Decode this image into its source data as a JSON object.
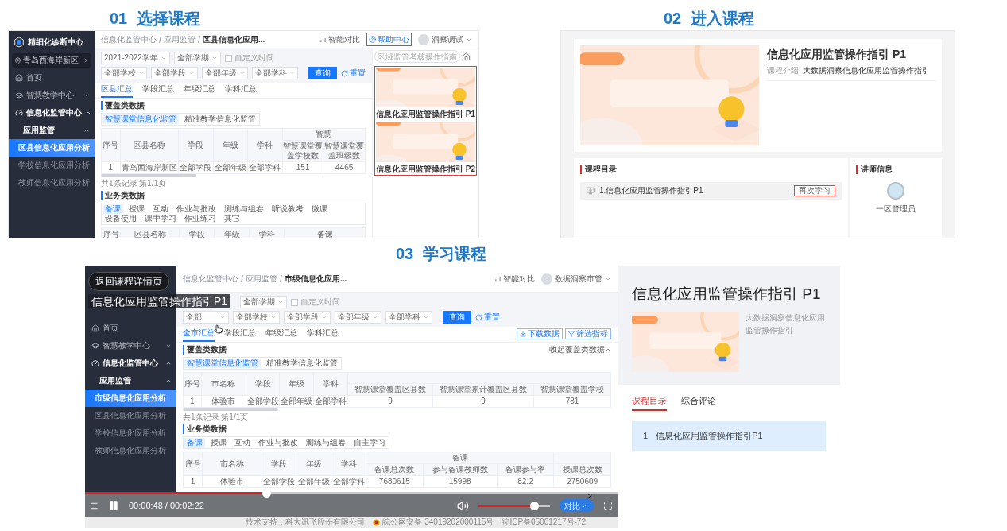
{
  "headings": [
    {
      "number": "01",
      "title": "选择课程"
    },
    {
      "number": "02",
      "title": "进入课程"
    },
    {
      "number": "03",
      "title": "学习课程"
    }
  ],
  "step1": {
    "sidebar": {
      "logo": "精细化诊断中心",
      "region": "青岛西海岸新区",
      "nav": [
        {
          "label": "首页"
        },
        {
          "label": "智慧教学中心",
          "expanded": false
        },
        {
          "label": "信息化监管中心",
          "expanded": true,
          "children": [
            {
              "label": "应用监管",
              "expanded": true,
              "children": [
                {
                  "label": "区县信息化应用分析",
                  "selected": true
                },
                {
                  "label": "学校信息化应用分析",
                  "selected": false
                },
                {
                  "label": "教师信息化应用分析",
                  "selected": false
                }
              ]
            }
          ]
        }
      ]
    },
    "breadcrumb": [
      "信息化监管中心",
      "应用监管",
      "区县信息化应用..."
    ],
    "compare": "智能对比",
    "help": {
      "label": "帮助中心",
      "highlighted": true
    },
    "user": "洞察调试",
    "filters": [
      [
        {
          "kind": "select",
          "value": "2021-2022学年"
        },
        {
          "kind": "select",
          "value": "全部学期"
        },
        {
          "kind": "checkbox",
          "label": "自定义时间",
          "checked": false
        }
      ],
      [
        {
          "kind": "select",
          "value": "全部学校"
        },
        {
          "kind": "select",
          "value": "全部学段"
        },
        {
          "kind": "select",
          "value": "全部年级"
        },
        {
          "kind": "select",
          "value": "全部学科"
        },
        {
          "kind": "button",
          "label": "查询"
        },
        {
          "kind": "link",
          "label": "重置"
        }
      ]
    ],
    "tabs": [
      {
        "label": "区县汇总",
        "selected": true
      },
      {
        "label": "学段汇总",
        "selected": false
      },
      {
        "label": "年级汇总",
        "selected": false
      },
      {
        "label": "学科汇总",
        "selected": false
      }
    ],
    "coverage": {
      "title": "覆盖类数据",
      "subtabs": [
        {
          "label": "智慧课堂信息化监管",
          "selected": true
        },
        {
          "label": "精准教学信息化监管",
          "selected": false
        }
      ],
      "table": {
        "columns": [
          "序号",
          "区县名称",
          "学段",
          "年级",
          "学科"
        ],
        "groups": [
          {
            "label": "智慧",
            "columns": [
              "智慧课堂覆盖学校数",
              "智慧课堂覆盖班级数"
            ]
          }
        ],
        "rows": [
          [
            "1",
            "青岛西海岸新区",
            "全部学段",
            "全部年级",
            "全部学科",
            "151",
            "4465"
          ]
        ]
      },
      "pagination": "共1条记录 第1/1页"
    },
    "business": {
      "title": "业务类数据",
      "subtabs": [
        {
          "label": "备课",
          "selected": true
        },
        {
          "label": "授课",
          "selected": false
        },
        {
          "label": "互动",
          "selected": false
        },
        {
          "label": "作业与批改",
          "selected": false
        },
        {
          "label": "测练与组卷",
          "selected": false
        },
        {
          "label": "听说教考",
          "selected": false
        },
        {
          "label": "微课",
          "selected": false
        },
        {
          "label": "设备使用",
          "selected": false
        },
        {
          "label": "课中学习",
          "selected": false
        },
        {
          "label": "作业练习",
          "selected": false
        },
        {
          "label": "其它",
          "selected": false
        }
      ],
      "table": {
        "columns": [
          "序号",
          "区县名称",
          "学段",
          "年级",
          "学科"
        ],
        "groups": [
          {
            "label": "备课"
          }
        ]
      }
    },
    "help_panel": {
      "search_placeholder": "区域监管考核操作指南",
      "highlighted": true,
      "cards": [
        {
          "kind": "picture",
          "title": "信息化应用监管操作指引 P1"
        },
        {
          "kind": "picture",
          "title": "信息化应用监管操作指引 P2"
        }
      ]
    }
  },
  "step2": {
    "course": {
      "kind": "picture",
      "title": "信息化应用监管操作指引 P1",
      "intro_label": "课程介绍:",
      "intro": "大数据洞察信息化应用监管操作指引"
    },
    "catalog": {
      "title": "课程目录",
      "items": [
        {
          "title": "1.信息化应用监管操作指引P1",
          "action": "再次学习",
          "highlighted": true
        }
      ]
    },
    "lecturer": {
      "title": "讲师信息",
      "name": "一区管理员"
    }
  },
  "step3": {
    "player": {
      "back": "返回课程详情页",
      "title": "信息化应用监管操作指引P1",
      "page": {
        "sidebar": {
          "nav": [
            {
              "label": "首页"
            },
            {
              "label": "智慧教学中心",
              "expanded": false
            },
            {
              "label": "信息化监管中心",
              "expanded": true,
              "children": [
                {
                  "label": "应用监管",
                  "expanded": true,
                  "children": [
                    {
                      "label": "市级信息化应用分析",
                      "selected": true
                    },
                    {
                      "label": "区县信息化应用分析",
                      "selected": false
                    },
                    {
                      "label": "学校信息化应用分析",
                      "selected": false
                    },
                    {
                      "label": "教师信息化应用分析",
                      "selected": false
                    }
                  ]
                }
              ]
            }
          ]
        },
        "breadcrumb": [
          "信息化监管中心",
          "应用监管",
          "市级信息化应用..."
        ],
        "compare": "智能对比",
        "user": "数据洞察市管",
        "filters": [
          [
            {
              "kind": "select",
              "value": "全部学期"
            },
            {
              "kind": "checkbox",
              "label": "自定义时间",
              "checked": false
            }
          ],
          [
            {
              "kind": "select",
              "value": "全部"
            },
            {
              "kind": "select",
              "value": "全部学校"
            },
            {
              "kind": "select",
              "value": "全部学段"
            },
            {
              "kind": "select",
              "value": "全部年级"
            },
            {
              "kind": "select",
              "value": "全部学科"
            },
            {
              "kind": "button",
              "label": "查询"
            },
            {
              "kind": "link",
              "label": "重置"
            }
          ]
        ],
        "tabs": [
          {
            "label": "全市汇总",
            "selected": true
          },
          {
            "label": "学段汇总",
            "selected": false
          },
          {
            "label": "年级汇总",
            "selected": false
          },
          {
            "label": "学科汇总",
            "selected": false
          }
        ],
        "tab_actions": [
          "下载数据",
          "筛选指标"
        ],
        "coverage": {
          "title": "覆盖类数据",
          "toggle": "收起覆盖类数据",
          "subtabs": [
            {
              "label": "智慧课堂信息化监管",
              "selected": true
            },
            {
              "label": "精准教学信息化监管",
              "selected": false
            }
          ],
          "table": {
            "columns": [
              "序号",
              "市名称",
              "学段",
              "年级",
              "学科"
            ],
            "groups": [
              {
                "columns": [
                  "智慧课堂覆盖区县数",
                  "智慧课堂累计覆盖区县数",
                  "智慧课堂覆盖学校"
                ]
              }
            ],
            "rows": [
              [
                "1",
                "体验市",
                "全部学段",
                "全部年级",
                "全部学科",
                "9",
                "9",
                "781"
              ]
            ]
          },
          "pagination": "共1条记录 第1/1页"
        },
        "business": {
          "title": "业务类数据",
          "subtabs": [
            {
              "label": "备课",
              "selected": true
            },
            {
              "label": "授课",
              "selected": false
            },
            {
              "label": "互动",
              "selected": false
            },
            {
              "label": "作业与批改",
              "selected": false
            },
            {
              "label": "测练与组卷",
              "selected": false
            },
            {
              "label": "自主学习",
              "selected": false
            }
          ],
          "table": {
            "columns": [
              "序号",
              "市名称",
              "学段",
              "年级",
              "学科"
            ],
            "groups": [
              {
                "label": "备课",
                "columns": [
                  "备课总次数",
                  "参与备课教师数",
                  "备课参与率"
                ]
              },
              {
                "columns": [
                  "授课总次数"
                ]
              }
            ],
            "rows": [
              [
                "1",
                "体验市",
                "全部学段",
                "全部年级",
                "全部学科",
                "7680615",
                "15998",
                "82.2",
                "2750609"
              ]
            ]
          }
        }
      },
      "progress": {
        "level": 0.34
      },
      "playing": true,
      "time": "00:00:48 / 00:02:22",
      "volume": {
        "level": 0.78
      },
      "compare": {
        "label": "对比",
        "count": "2"
      },
      "footer": [
        "技术支持：科大讯飞股份有限公司",
        "皖公网安备 34019202000115号",
        "皖ICP备05001217号-72"
      ]
    },
    "detail": {
      "title": "信息化应用监管操作指引 P1",
      "description": "大数据洞察信息化应用监管操作指引",
      "tabs": [
        {
          "label": "课程目录",
          "selected": true
        },
        {
          "label": "综合评论",
          "selected": false
        }
      ],
      "items": [
        {
          "index": "1",
          "title": "信息化应用监管操作指引P1"
        }
      ]
    }
  }
}
